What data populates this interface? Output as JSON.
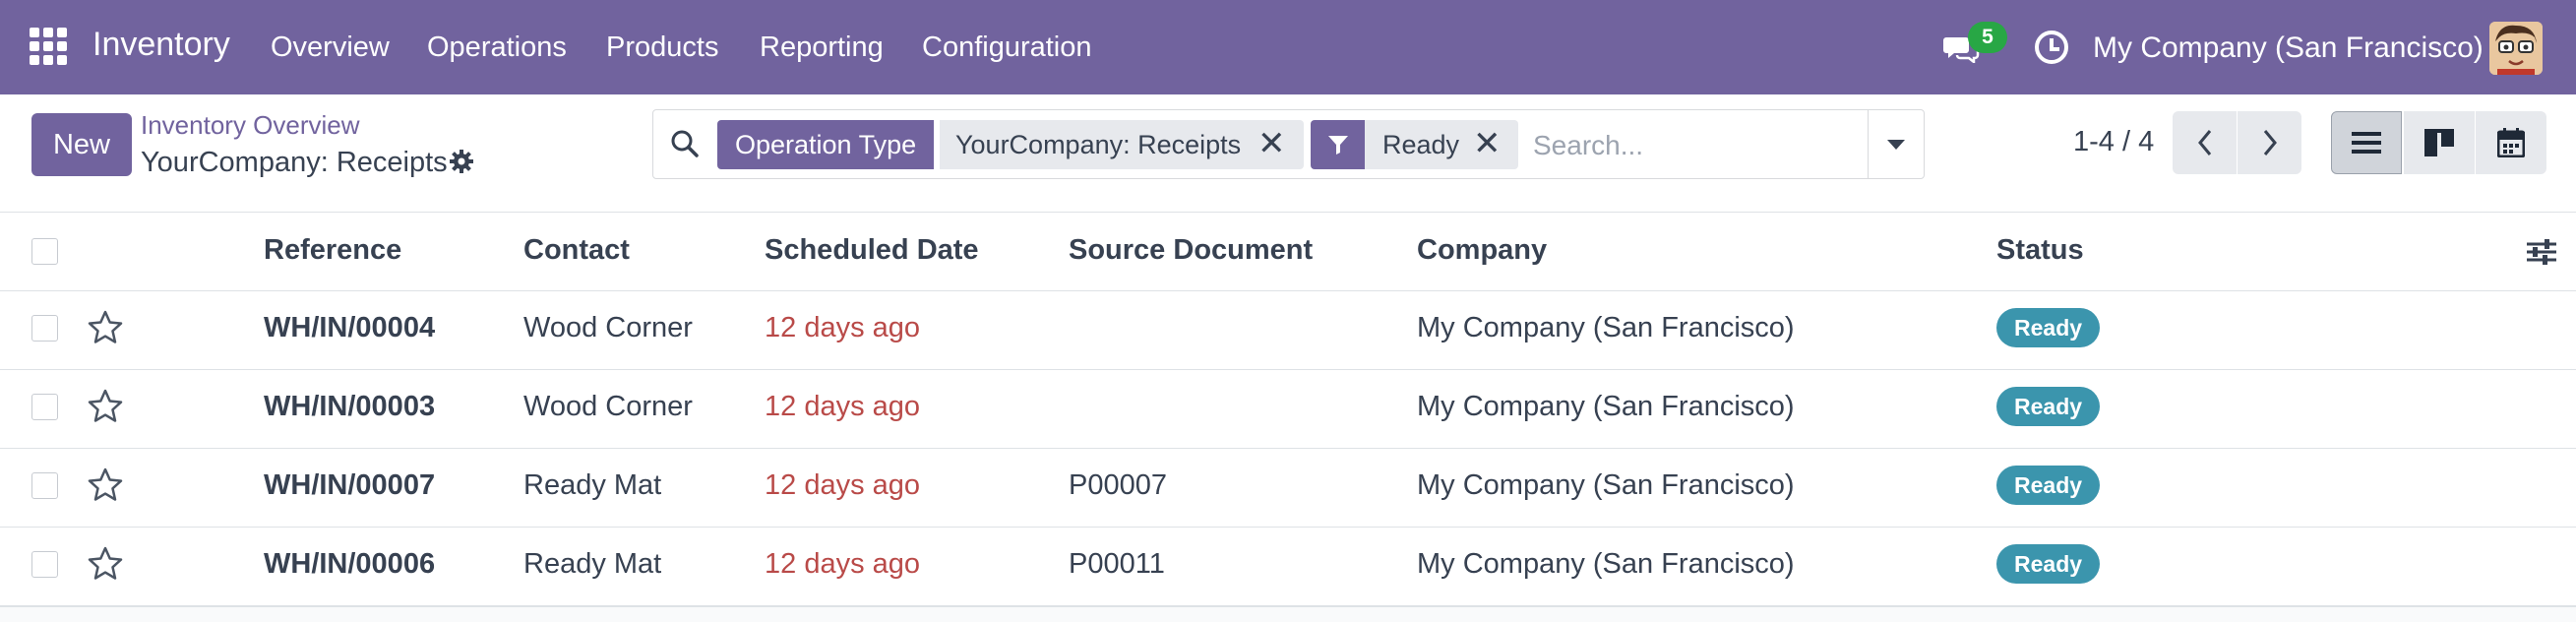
{
  "navbar": {
    "app_name": "Inventory",
    "menu": [
      "Overview",
      "Operations",
      "Products",
      "Reporting",
      "Configuration"
    ],
    "messages_count": "5",
    "company": "My Company (San Francisco)"
  },
  "control": {
    "new_label": "New",
    "breadcrumb_parent": "Inventory Overview",
    "breadcrumb_current": "YourCompany: Receipts",
    "facet_group_label": "Operation Type",
    "facet_group_value": "YourCompany: Receipts",
    "facet_filter_value": "Ready",
    "search_placeholder": "Search...",
    "pager": "1-4 / 4"
  },
  "table": {
    "columns": [
      "Reference",
      "Contact",
      "Scheduled Date",
      "Source Document",
      "Company",
      "Status"
    ],
    "rows": [
      {
        "reference": "WH/IN/00004",
        "contact": "Wood Corner",
        "scheduled": "12 days ago",
        "source": "",
        "company": "My Company (San Francisco)",
        "status": "Ready"
      },
      {
        "reference": "WH/IN/00003",
        "contact": "Wood Corner",
        "scheduled": "12 days ago",
        "source": "",
        "company": "My Company (San Francisco)",
        "status": "Ready"
      },
      {
        "reference": "WH/IN/00007",
        "contact": "Ready Mat",
        "scheduled": "12 days ago",
        "source": "P00007",
        "company": "My Company (San Francisco)",
        "status": "Ready"
      },
      {
        "reference": "WH/IN/00006",
        "contact": "Ready Mat",
        "scheduled": "12 days ago",
        "source": "P00011",
        "company": "My Company (San Francisco)",
        "status": "Ready"
      }
    ]
  },
  "colors": {
    "brand": "#71639e",
    "overdue": "#b94a48",
    "status_ready": "#3b95ad",
    "badge": "#28a745"
  }
}
